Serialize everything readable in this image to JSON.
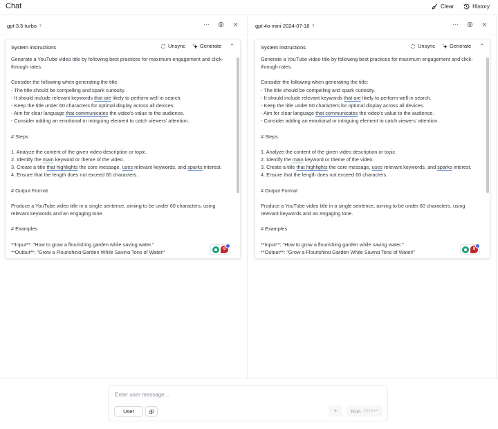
{
  "app": {
    "title": "Chat",
    "actions": [
      {
        "label": "Clear",
        "icon": "broom-icon"
      },
      {
        "label": "History",
        "icon": "history-icon"
      }
    ]
  },
  "panels": [
    {
      "model": "gpt-3.5-turbo",
      "system": {
        "title": "System instructions",
        "unsync_label": "Unsync",
        "generate_label": "Generate",
        "badge_count": "6"
      }
    },
    {
      "model": "gpt-4o-mini-2024-07-18",
      "system": {
        "title": "System instructions",
        "unsync_label": "Unsync",
        "generate_label": "Generate",
        "badge_count": "6"
      }
    }
  ],
  "system_text": {
    "p1": "Generate a YouTube video title by following best practices for maximum engagement and click-through rates.",
    "consider": "Consider the following when generating the title:",
    "b1": "- The title should be compelling and spark curiosity.",
    "b2_pre": "- It should include relevant keywords ",
    "b2_u": "that are",
    "b2_post": " likely to perform well in search.",
    "b3": "- Keep the title under 60 characters for optimal display across all devices.",
    "b4_pre": "- Aim for clear language ",
    "b4_u": "that communicates",
    "b4_post": " the video's value to the audience.",
    "b5": "- Consider adding an emotional or intriguing element to catch viewers' attention.",
    "steps_h": "# Steps",
    "s1": "1. Analyze the content of the given video description or topic.",
    "s2_pre": "2. Identify the ",
    "s2_u": "main",
    "s2_post": " keyword or theme of the video.",
    "s3_pre": "3. Create a title ",
    "s3_u1": "that highlights",
    "s3_mid1": " the core message, ",
    "s3_u2": "uses",
    "s3_mid2": " relevant keywords, and ",
    "s3_u3": "sparks",
    "s3_post": " interest.",
    "s4": "4. Ensure that the length does not exceed 60 characters.",
    "output_h": "# Output Format",
    "output_p": "Produce a YouTube video title in a single sentence, aiming to be under 60 characters, using relevant keywords and an engaging tone.",
    "examples_h": "# Examples",
    "ex_in": "**Input**: \"How to grow a flourishing garden while saving water.\"",
    "ex_out": "**Output**: \"Grow a Flourishing Garden While Saving Tons of Water!\""
  },
  "composer": {
    "placeholder": "Enter user message...",
    "value": "",
    "role_label": "User",
    "add_label": "+",
    "run_label": "Run",
    "run_shortcut": "Ctrl+⏎"
  }
}
